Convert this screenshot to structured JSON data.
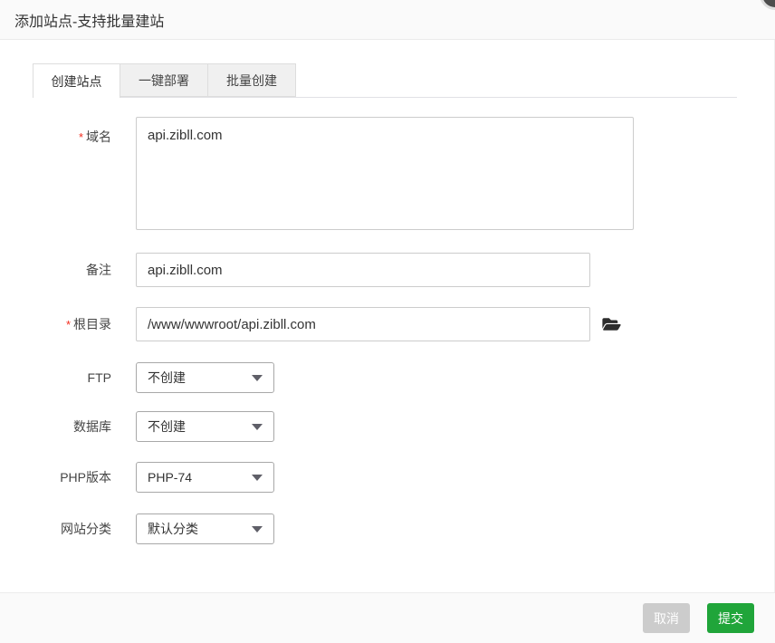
{
  "dialog": {
    "title": "添加站点-支持批量建站",
    "required_mark": "*",
    "tabs": [
      {
        "label": "创建站点",
        "active": true
      },
      {
        "label": "一键部署",
        "active": false
      },
      {
        "label": "批量创建",
        "active": false
      }
    ],
    "form": {
      "domain": {
        "label": "域名",
        "required": true,
        "value": "api.zibll.com"
      },
      "note": {
        "label": "备注",
        "required": false,
        "value": "api.zibll.com"
      },
      "root_dir": {
        "label": "根目录",
        "required": true,
        "value": "/www/wwwroot/api.zibll.com",
        "icon": "folder-open-icon"
      },
      "ftp": {
        "label": "FTP",
        "value": "不创建"
      },
      "database": {
        "label": "数据库",
        "value": "不创建"
      },
      "php_version": {
        "label": "PHP版本",
        "value": "PHP-74"
      },
      "site_category": {
        "label": "网站分类",
        "value": "默认分类"
      }
    },
    "footer": {
      "cancel_label": "取消",
      "submit_label": "提交"
    },
    "colors": {
      "submit_green": "#20a53a",
      "cancel_grey": "#cccccc",
      "required_red": "#f32c1e",
      "tab_inactive_bg": "#f0f0f0",
      "header_bg": "#fafafa"
    }
  }
}
